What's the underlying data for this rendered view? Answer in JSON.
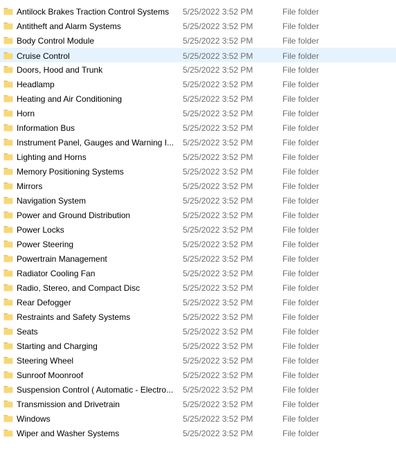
{
  "colors": {
    "folder_fill": "#f8d775",
    "folder_tab": "#e9b949",
    "selected_row": "#e5f3ff",
    "meta_text": "#6d6d6d"
  },
  "icons": {
    "row_icon": "folder-icon"
  },
  "selected_index": 3,
  "rows": [
    {
      "name": "Antilock Brakes  Traction Control Systems",
      "date": "5/25/2022 3:52 PM",
      "type": "File folder"
    },
    {
      "name": "Antitheft and Alarm Systems",
      "date": "5/25/2022 3:52 PM",
      "type": "File folder"
    },
    {
      "name": "Body Control Module",
      "date": "5/25/2022 3:52 PM",
      "type": "File folder"
    },
    {
      "name": "Cruise Control",
      "date": "5/25/2022 3:52 PM",
      "type": "File folder"
    },
    {
      "name": "Doors, Hood and Trunk",
      "date": "5/25/2022 3:52 PM",
      "type": "File folder"
    },
    {
      "name": "Headlamp",
      "date": "5/25/2022 3:52 PM",
      "type": "File folder"
    },
    {
      "name": "Heating and Air Conditioning",
      "date": "5/25/2022 3:52 PM",
      "type": "File folder"
    },
    {
      "name": "Horn",
      "date": "5/25/2022 3:52 PM",
      "type": "File folder"
    },
    {
      "name": "Information Bus",
      "date": "5/25/2022 3:52 PM",
      "type": "File folder"
    },
    {
      "name": "Instrument Panel, Gauges and Warning I...",
      "date": "5/25/2022 3:52 PM",
      "type": "File folder"
    },
    {
      "name": "Lighting and Horns",
      "date": "5/25/2022 3:52 PM",
      "type": "File folder"
    },
    {
      "name": "Memory Positioning Systems",
      "date": "5/25/2022 3:52 PM",
      "type": "File folder"
    },
    {
      "name": "Mirrors",
      "date": "5/25/2022 3:52 PM",
      "type": "File folder"
    },
    {
      "name": "Navigation System",
      "date": "5/25/2022 3:52 PM",
      "type": "File folder"
    },
    {
      "name": "Power and Ground Distribution",
      "date": "5/25/2022 3:52 PM",
      "type": "File folder"
    },
    {
      "name": "Power Locks",
      "date": "5/25/2022 3:52 PM",
      "type": "File folder"
    },
    {
      "name": "Power Steering",
      "date": "5/25/2022 3:52 PM",
      "type": "File folder"
    },
    {
      "name": "Powertrain Management",
      "date": "5/25/2022 3:52 PM",
      "type": "File folder"
    },
    {
      "name": "Radiator Cooling Fan",
      "date": "5/25/2022 3:52 PM",
      "type": "File folder"
    },
    {
      "name": "Radio, Stereo, and Compact Disc",
      "date": "5/25/2022 3:52 PM",
      "type": "File folder"
    },
    {
      "name": "Rear Defogger",
      "date": "5/25/2022 3:52 PM",
      "type": "File folder"
    },
    {
      "name": "Restraints and Safety Systems",
      "date": "5/25/2022 3:52 PM",
      "type": "File folder"
    },
    {
      "name": "Seats",
      "date": "5/25/2022 3:52 PM",
      "type": "File folder"
    },
    {
      "name": "Starting and Charging",
      "date": "5/25/2022 3:52 PM",
      "type": "File folder"
    },
    {
      "name": "Steering Wheel",
      "date": "5/25/2022 3:52 PM",
      "type": "File folder"
    },
    {
      "name": "Sunroof  Moonroof",
      "date": "5/25/2022 3:52 PM",
      "type": "File folder"
    },
    {
      "name": "Suspension Control ( Automatic - Electro...",
      "date": "5/25/2022 3:52 PM",
      "type": "File folder"
    },
    {
      "name": "Transmission and Drivetrain",
      "date": "5/25/2022 3:52 PM",
      "type": "File folder"
    },
    {
      "name": "Windows",
      "date": "5/25/2022 3:52 PM",
      "type": "File folder"
    },
    {
      "name": "Wiper and Washer Systems",
      "date": "5/25/2022 3:52 PM",
      "type": "File folder"
    }
  ]
}
